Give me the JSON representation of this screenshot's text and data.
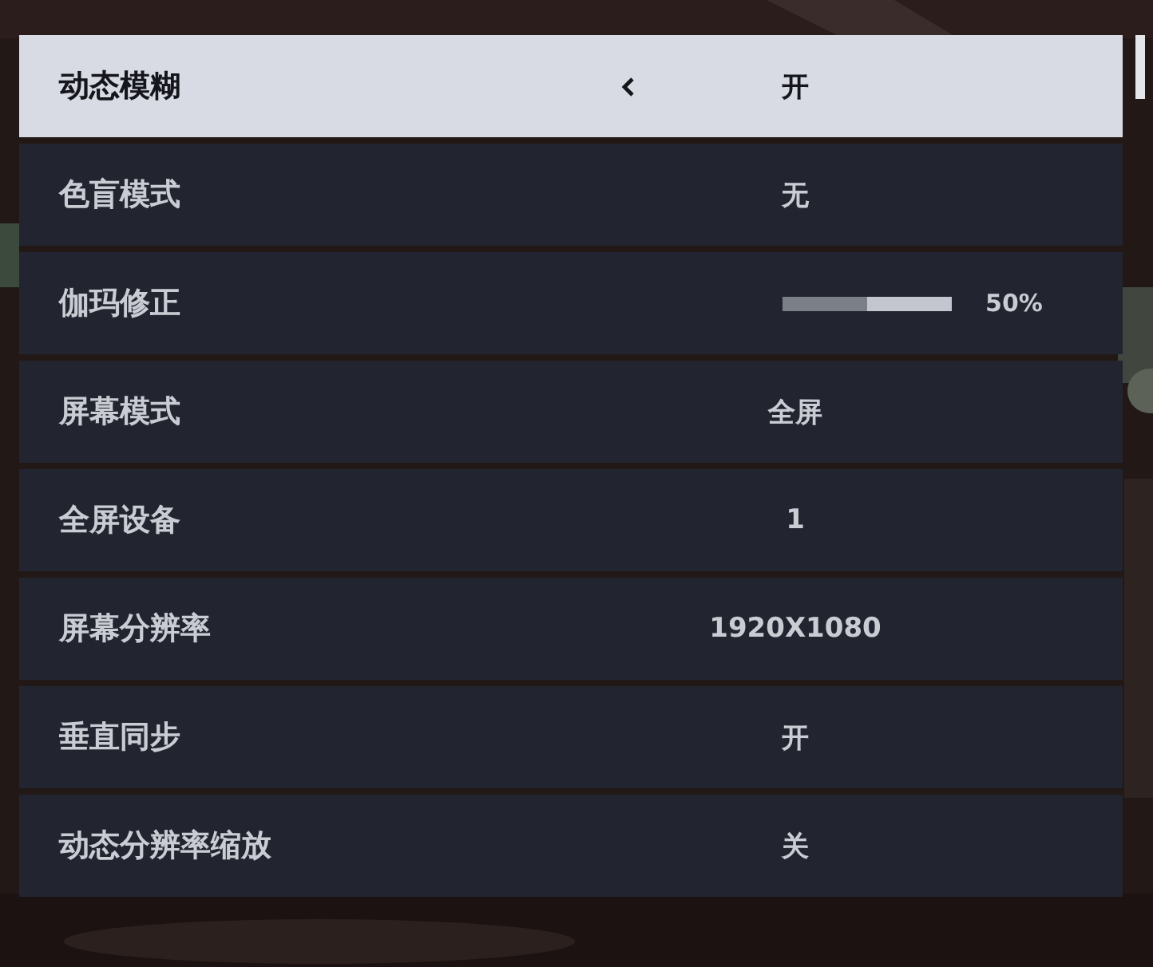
{
  "settings": [
    {
      "kind": "option",
      "label": "动态模糊",
      "value": "开",
      "selected": true
    },
    {
      "kind": "option",
      "label": "色盲模式",
      "value": "无",
      "selected": false
    },
    {
      "kind": "slider",
      "label": "伽玛修正",
      "level": 0.5,
      "reading": "50%",
      "selected": false
    },
    {
      "kind": "option",
      "label": "屏幕模式",
      "value": "全屏",
      "selected": false
    },
    {
      "kind": "option",
      "label": "全屏设备",
      "value": "1",
      "selected": false
    },
    {
      "kind": "option",
      "label": "屏幕分辨率",
      "value": "1920X1080",
      "selected": false
    },
    {
      "kind": "option",
      "label": "垂直同步",
      "value": "开",
      "selected": false
    },
    {
      "kind": "option",
      "label": "动态分辨率缩放",
      "value": "关",
      "selected": false
    }
  ]
}
